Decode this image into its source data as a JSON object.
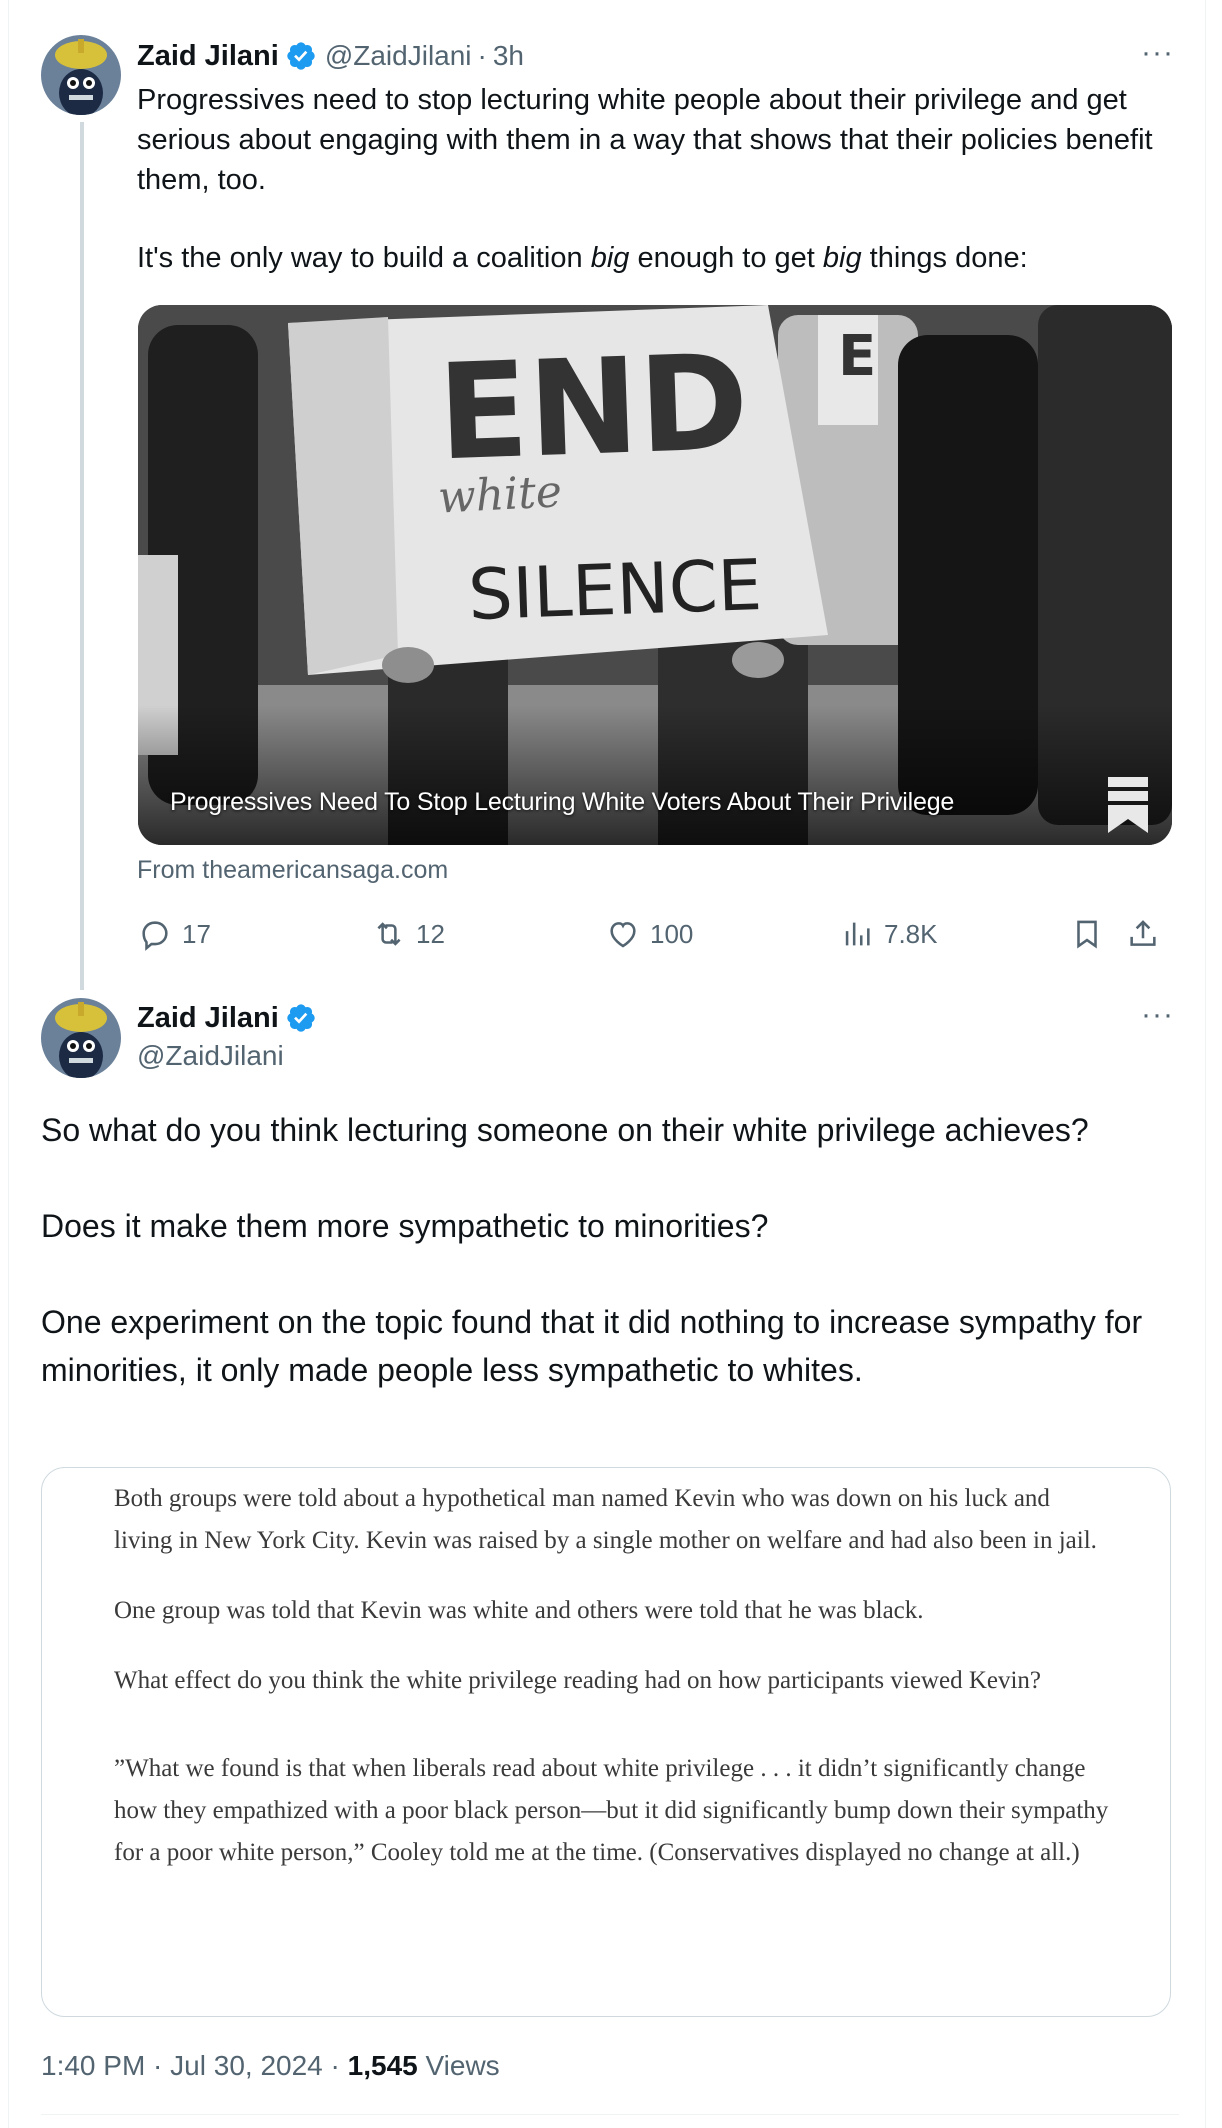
{
  "colors": {
    "accent": "#1d9bf0",
    "muted": "#536471",
    "text": "#0f1419"
  },
  "tweet1": {
    "author_name": "Zaid Jilani",
    "author_handle": "@ZaidJilani",
    "separator": "·",
    "time": "3h",
    "more": "···",
    "text_p1": "Progressives need to stop lecturing white people about their privilege and get serious about engaging with them in a way that shows that their policies benefit them, too.",
    "text_p2_a": "It's the only way to build a coalition ",
    "text_p2_b": "big",
    "text_p2_c": " enough to get ",
    "text_p2_d": "big",
    "text_p2_e": " things done:",
    "card": {
      "sign_line1": "END",
      "sign_line2": "white",
      "sign_line3": "SILENCE",
      "caption": "Progressives Need To Stop Lecturing White Voters About Their Privilege",
      "source": "From theamericansaga.com"
    },
    "actions": {
      "replies": "17",
      "reposts": "12",
      "likes": "100",
      "views": "7.8K"
    }
  },
  "tweet2": {
    "author_name": "Zaid Jilani",
    "author_handle": "@ZaidJilani",
    "more": "···",
    "text_p1": "So what do you think lecturing someone on their white privilege achieves?",
    "text_p2": "Does it make them more sympathetic to minorities?",
    "text_p3": "One experiment on the topic found that it did nothing to increase sympathy for minorities, it only made people less sympathetic to whites.",
    "quote": {
      "p1": "Both groups were told about a hypothetical man named Kevin who was down on his luck and living in New York City. Kevin was raised by a single mother on welfare and had also been in jail.",
      "p2": "One group was told that Kevin was white and others were told that he was black.",
      "p3": "What effect do you think the white privilege reading had on how participants viewed Kevin?",
      "p4": "”What we found is that when liberals read about white privilege . . . it didn’t significantly change how they empathized with a poor black person—but it did significantly bump down their sympathy for a poor white person,” Cooley told me at the time. (Conservatives displayed no change at all.)"
    },
    "meta": {
      "time": "1:40 PM",
      "dot1": " · ",
      "date": "Jul 30, 2024",
      "dot2": " · ",
      "views": "1,545",
      "views_label": " Views"
    }
  }
}
